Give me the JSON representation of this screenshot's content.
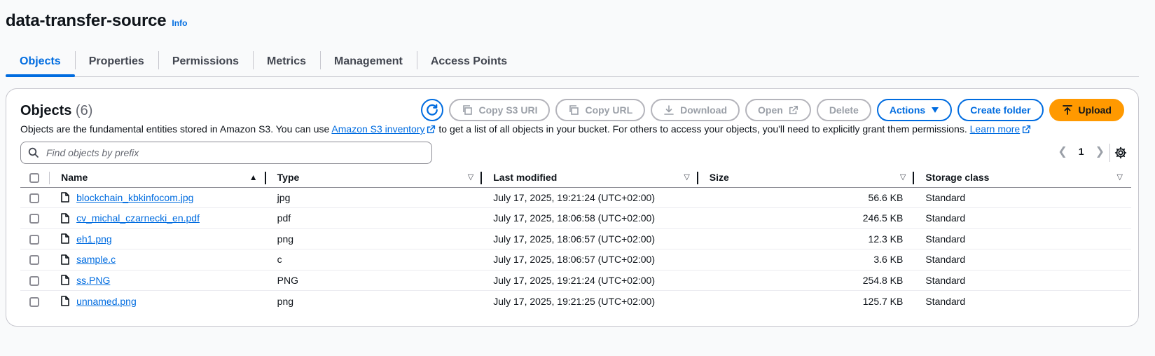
{
  "page": {
    "title": "data-transfer-source",
    "info_label": "Info"
  },
  "tabs": [
    {
      "label": "Objects",
      "active": true
    },
    {
      "label": "Properties",
      "active": false
    },
    {
      "label": "Permissions",
      "active": false
    },
    {
      "label": "Metrics",
      "active": false
    },
    {
      "label": "Management",
      "active": false
    },
    {
      "label": "Access Points",
      "active": false
    }
  ],
  "objects_panel": {
    "heading": "Objects",
    "count": "(6)",
    "buttons": {
      "copy_s3_uri": "Copy S3 URI",
      "copy_url": "Copy URL",
      "download": "Download",
      "open": "Open",
      "delete": "Delete",
      "actions": "Actions",
      "create_folder": "Create folder",
      "upload": "Upload"
    },
    "description": {
      "part1": "Objects are the fundamental entities stored in Amazon S3. You can use ",
      "link1": "Amazon S3 inventory",
      "part2": " to get a list of all objects in your bucket. For others to access your objects, you'll need to explicitly grant them permissions. ",
      "link2": "Learn more"
    },
    "search_placeholder": "Find objects by prefix",
    "pagination": {
      "current_page": "1"
    }
  },
  "table": {
    "columns": {
      "name": "Name",
      "type": "Type",
      "last_modified": "Last modified",
      "size": "Size",
      "storage_class": "Storage class"
    },
    "rows": [
      {
        "name": "blockchain_kbkinfocom.jpg",
        "type": "jpg",
        "last_modified": "July 17, 2025, 19:21:24 (UTC+02:00)",
        "size": "56.6 KB",
        "storage_class": "Standard"
      },
      {
        "name": "cv_michal_czarnecki_en.pdf",
        "type": "pdf",
        "last_modified": "July 17, 2025, 18:06:58 (UTC+02:00)",
        "size": "246.5 KB",
        "storage_class": "Standard"
      },
      {
        "name": "eh1.png",
        "type": "png",
        "last_modified": "July 17, 2025, 18:06:57 (UTC+02:00)",
        "size": "12.3 KB",
        "storage_class": "Standard"
      },
      {
        "name": "sample.c",
        "type": "c",
        "last_modified": "July 17, 2025, 18:06:57 (UTC+02:00)",
        "size": "3.6 KB",
        "storage_class": "Standard"
      },
      {
        "name": "ss.PNG",
        "type": "PNG",
        "last_modified": "July 17, 2025, 19:21:24 (UTC+02:00)",
        "size": "254.8 KB",
        "storage_class": "Standard"
      },
      {
        "name": "unnamed.png",
        "type": "png",
        "last_modified": "July 17, 2025, 19:21:25 (UTC+02:00)",
        "size": "125.7 KB",
        "storage_class": "Standard"
      }
    ]
  },
  "colors": {
    "accent": "#006ce0",
    "upload": "#ff9900",
    "disabled": "#9ba0a8"
  },
  "icons": {
    "refresh": "refresh-icon",
    "copy": "copy-icon",
    "download": "download-icon",
    "external": "external-link-icon",
    "caret": "caret-down-icon",
    "upload": "upload-icon",
    "search": "search-icon",
    "settings": "settings-icon",
    "file": "file-icon"
  }
}
